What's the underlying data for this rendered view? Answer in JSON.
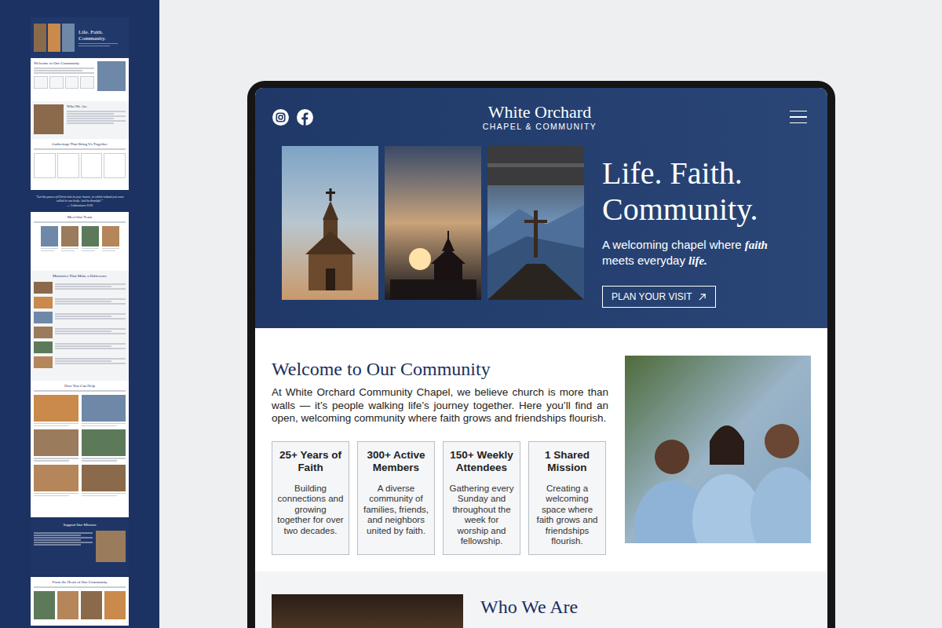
{
  "sidebar": {
    "items": [
      {
        "kind": "page",
        "sections": [
          {
            "kind": "hero",
            "title": "Life. Faith. Community."
          },
          {
            "kind": "intro",
            "title": "Welcome to Our Community"
          },
          {
            "kind": "about",
            "title": "Who We Are"
          },
          {
            "kind": "cards",
            "title": "Gatherings That Bring Us Together"
          }
        ]
      },
      {
        "kind": "quote",
        "text": "“Let the peace of Christ rule in your hearts, to which indeed you were called in one body. And be thankful.”",
        "source": "— Colossians 3:15"
      },
      {
        "kind": "page",
        "sections": [
          {
            "kind": "team",
            "title": "Meet Our Team"
          },
          {
            "kind": "list",
            "title": "Ministries That Make a Difference"
          },
          {
            "kind": "grid",
            "title": "How You Can Help"
          }
        ]
      },
      {
        "kind": "page",
        "sections": [
          {
            "kind": "banner",
            "title": "Support Our Mission"
          }
        ]
      },
      {
        "kind": "page",
        "sections": [
          {
            "kind": "gallery",
            "title": "From the Heart of Our Community"
          }
        ]
      }
    ]
  },
  "header": {
    "logo_title": "White Orchard",
    "logo_subtitle": "CHAPEL & COMMUNITY"
  },
  "hero": {
    "title": "Life. Faith. Community.",
    "subtitle": [
      {
        "text": "A welcoming chapel where ",
        "emphasis": false
      },
      {
        "text": "faith",
        "emphasis": true
      },
      {
        "text": " meets everyday ",
        "emphasis": false
      },
      {
        "text": "life.",
        "emphasis": true
      }
    ],
    "button": "PLAN YOUR VISIT"
  },
  "welcome": {
    "title": "Welcome to Our Community",
    "body": "At White Orchard Community Chapel, we believe church is more than walls — it’s people walking life’s journey together. Here you’ll find an open, welcoming community where faith grows and friendships flourish.",
    "stats": [
      {
        "title": "25+ Years of Faith",
        "body": "Building connections and growing together for over two decades."
      },
      {
        "title": "300+ Active Members",
        "body": "A diverse community of families, friends, and neighbors united by faith."
      },
      {
        "title": "150+ Weekly Attendees",
        "body": "Gathering every Sunday and throughout the week for worship and fellowship."
      },
      {
        "title": "1 Shared Mission",
        "body": "Creating a welcoming space where faith grows and friendships flourish."
      }
    ]
  },
  "who_we_are": {
    "title": "Who We Are"
  }
}
